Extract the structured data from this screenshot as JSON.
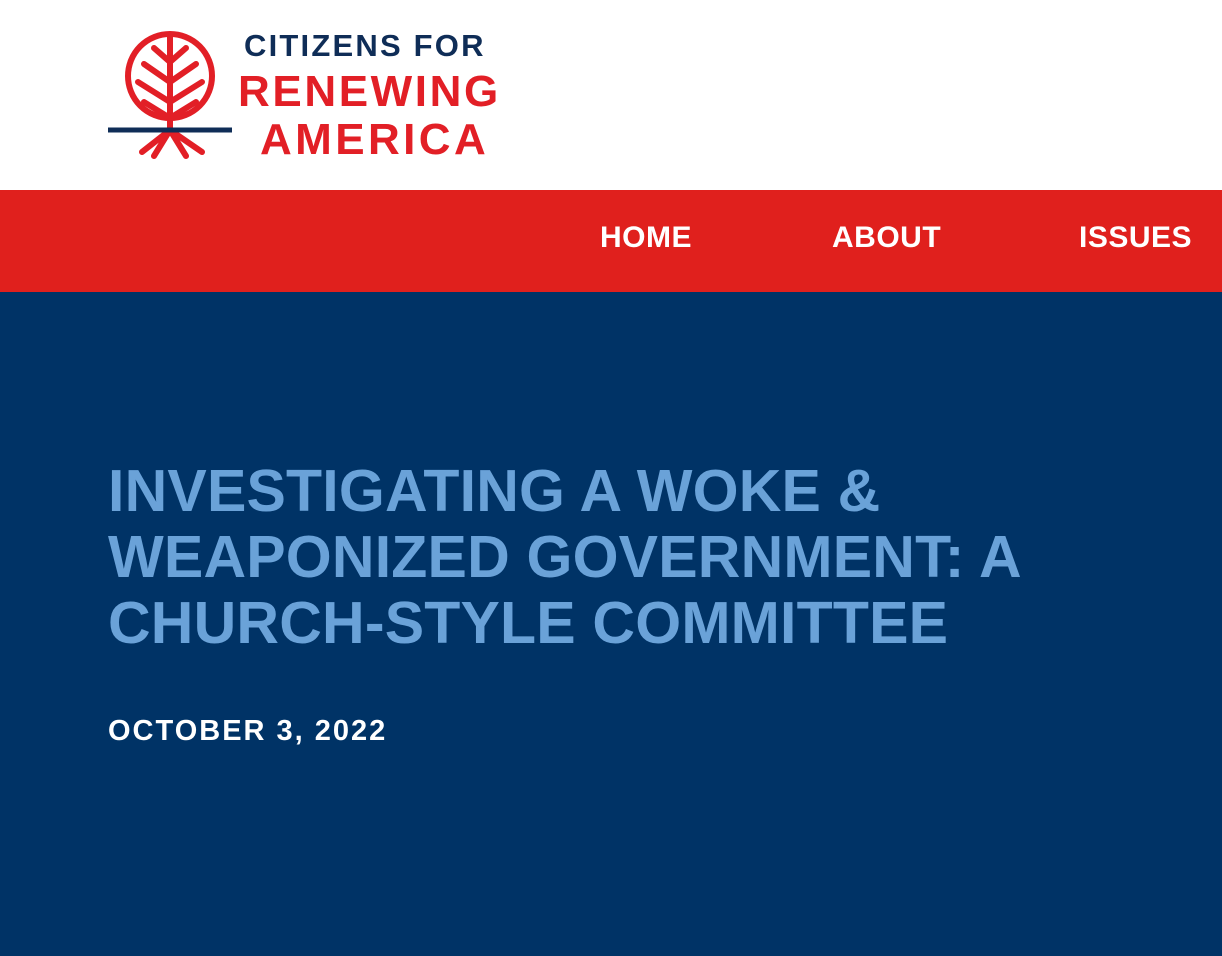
{
  "brand": {
    "line1": "CITIZENS FOR",
    "line2": "RENEWING",
    "line3": "AMERICA",
    "icon": "tree-roots-logo-icon",
    "colors": {
      "navy": "#0f2d57",
      "red": "#e21f26"
    }
  },
  "nav": {
    "items": [
      {
        "label": "HOME"
      },
      {
        "label": "ABOUT"
      },
      {
        "label": "ISSUES"
      }
    ],
    "background": "#e0201d"
  },
  "article": {
    "title": "INVESTIGATING A WOKE & WEAPONIZED GOVERNMENT: A CHURCH-STYLE COMMITTEE",
    "date": "OCTOBER 3, 2022",
    "background": "#003366",
    "title_color": "#6aa2d8"
  }
}
